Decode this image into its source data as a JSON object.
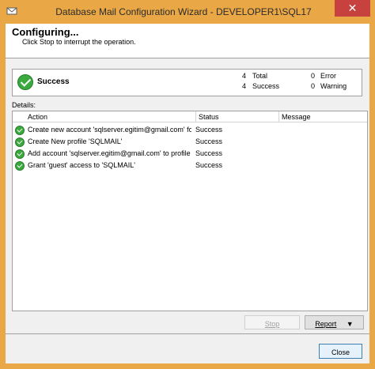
{
  "window": {
    "title": "Database Mail Configuration Wizard - DEVELOPER1\\SQL17",
    "close_glyph": "✕"
  },
  "header": {
    "title": "Configuring...",
    "subtitle": "Click Stop to interrupt the operation."
  },
  "summary": {
    "status": "Success",
    "total_count": "4",
    "total_label": "Total",
    "success_count": "4",
    "success_label": "Success",
    "error_count": "0",
    "error_label": "Error",
    "warning_count": "0",
    "warning_label": "Warning"
  },
  "details": {
    "label": "Details:",
    "columns": {
      "action": "Action",
      "status": "Status",
      "message": "Message"
    },
    "rows": [
      {
        "action": "Create new account 'sqlserver.egitim@gmail.com' for SM...",
        "status": "Success",
        "message": ""
      },
      {
        "action": "Create New profile 'SQLMAIL'",
        "status": "Success",
        "message": ""
      },
      {
        "action": "Add account 'sqlserver.egitim@gmail.com' to profile 'SQL...",
        "status": "Success",
        "message": ""
      },
      {
        "action": "Grant 'guest' access to 'SQLMAIL'",
        "status": "Success",
        "message": ""
      }
    ]
  },
  "buttons": {
    "stop": "Stop",
    "report": "Report",
    "report_arrow": "▼",
    "close": "Close"
  },
  "colors": {
    "frame": "#e9a845",
    "close_button": "#c7413f",
    "success_icon": "#3aa93e"
  }
}
